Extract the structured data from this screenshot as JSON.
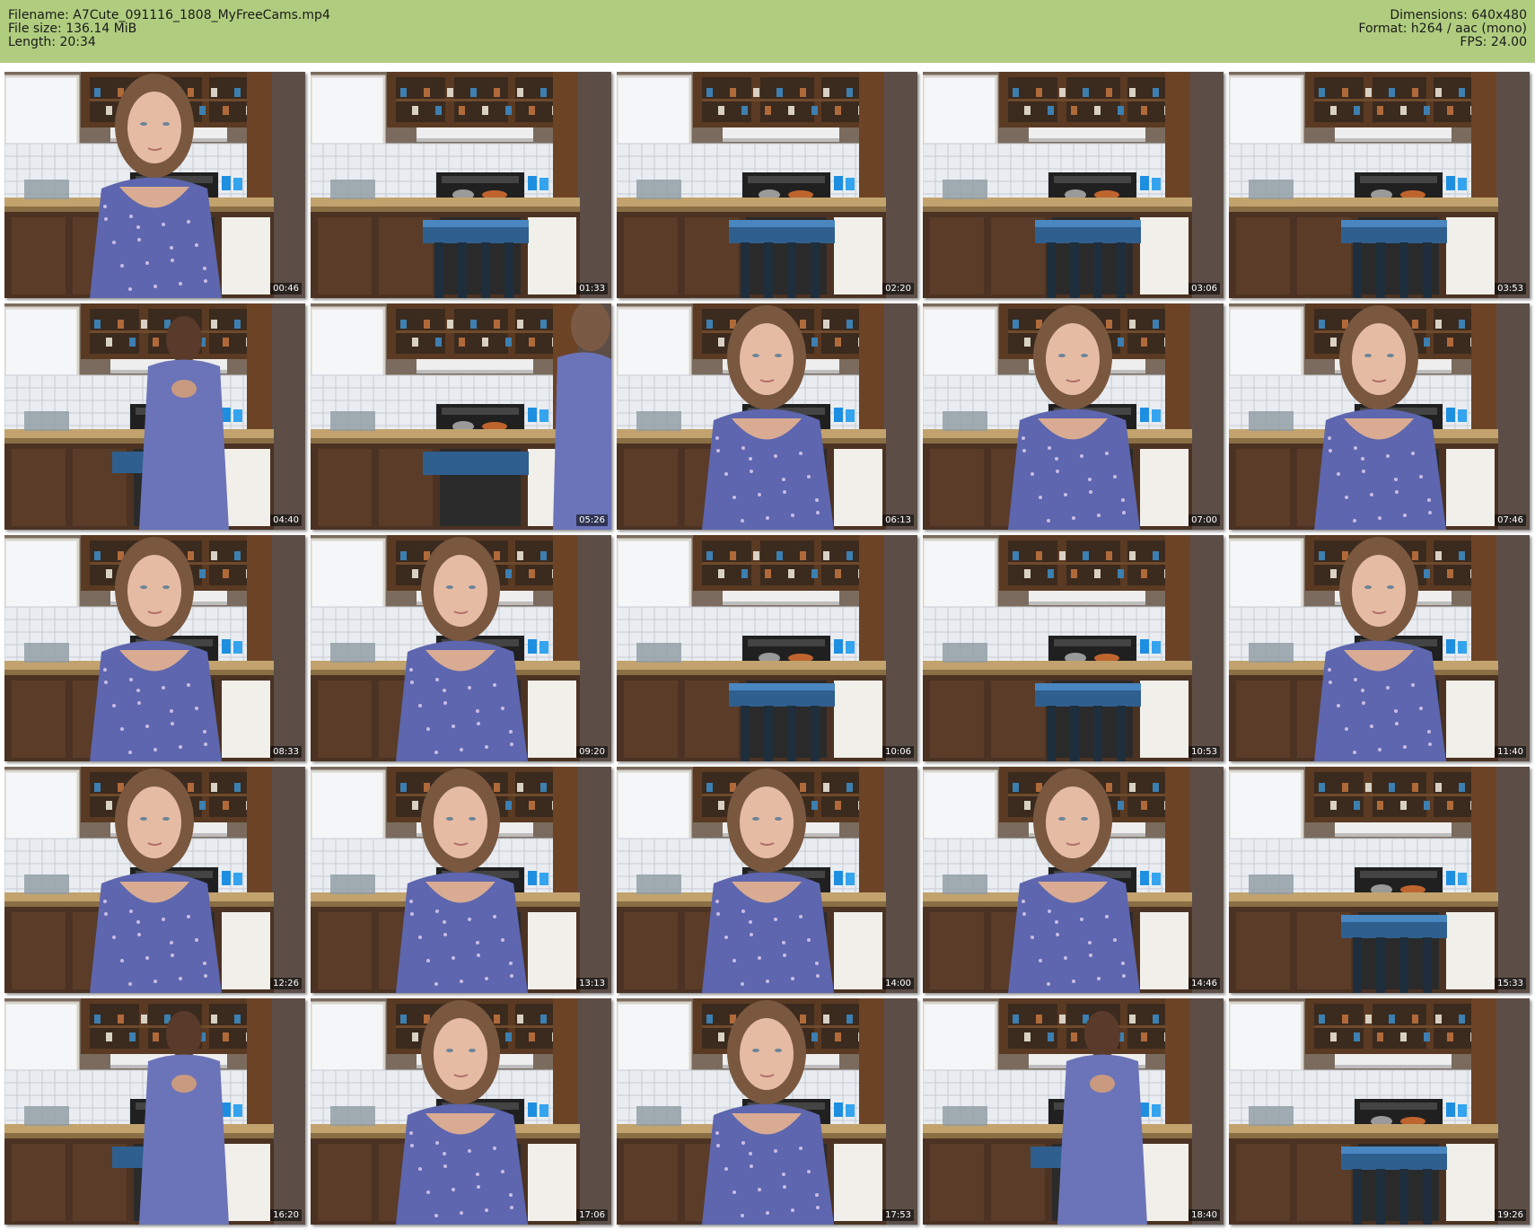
{
  "header": {
    "filename": "Filename: A7Cute_091116_1808_MyFreeCams.mp4",
    "filesize": "File size: 136.14 MiB",
    "length": "Length: 20:34",
    "dimensions": "Dimensions: 640x480",
    "format": "Format: h264 / aac (mono)",
    "fps": "FPS: 24.00",
    "background_color": "#b0cd7f"
  },
  "thumbnails": [
    {
      "time": "00:46",
      "scene": "person-center"
    },
    {
      "time": "01:33",
      "scene": "empty-chair"
    },
    {
      "time": "02:20",
      "scene": "empty-chair"
    },
    {
      "time": "03:06",
      "scene": "empty-chair"
    },
    {
      "time": "03:53",
      "scene": "empty-chair"
    },
    {
      "time": "04:40",
      "scene": "person-back"
    },
    {
      "time": "05:26",
      "scene": "person-right-edge"
    },
    {
      "time": "06:13",
      "scene": "person-center"
    },
    {
      "time": "07:00",
      "scene": "person-center"
    },
    {
      "time": "07:46",
      "scene": "person-center"
    },
    {
      "time": "08:33",
      "scene": "person-center"
    },
    {
      "time": "09:20",
      "scene": "person-center"
    },
    {
      "time": "10:06",
      "scene": "empty-chair"
    },
    {
      "time": "10:53",
      "scene": "empty-chair"
    },
    {
      "time": "11:40",
      "scene": "person-center"
    },
    {
      "time": "12:26",
      "scene": "person-center"
    },
    {
      "time": "13:13",
      "scene": "person-center"
    },
    {
      "time": "14:00",
      "scene": "person-center"
    },
    {
      "time": "14:46",
      "scene": "person-center"
    },
    {
      "time": "15:33",
      "scene": "empty-chair"
    },
    {
      "time": "16:20",
      "scene": "person-back"
    },
    {
      "time": "17:06",
      "scene": "person-center"
    },
    {
      "time": "17:53",
      "scene": "person-center"
    },
    {
      "time": "18:40",
      "scene": "person-back"
    },
    {
      "time": "19:26",
      "scene": "empty-chair"
    }
  ]
}
